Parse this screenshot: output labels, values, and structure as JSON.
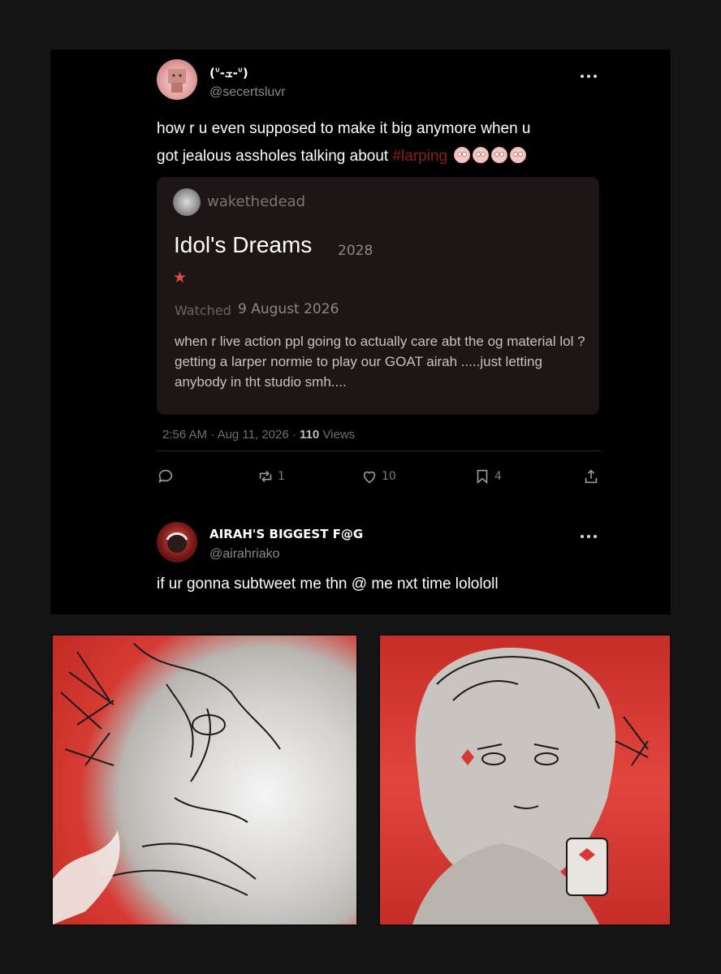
{
  "post": {
    "name": "(ᐡ-ܫ-ᐡ)",
    "handle": "@secertsluvr",
    "text_line1": "how r u even supposed to make it big anymore when u",
    "text_line2_prefix": "got jealous assholes talking about ",
    "hashtag": "#larping",
    "emoji_count": 4,
    "emoji_icon": "eye-roll-emoji-icon",
    "card": {
      "user": "wakethedead",
      "film_title": "Idol's Dreams",
      "film_year": "2028",
      "rating_stars": 1,
      "watched_label": "Watched",
      "watched_date": "9 August 2026",
      "review": "when r live action ppl going to actually care abt the og material lol ? getting a larper normie to play our GOAT airah .....just letting anybody in tht studio smh...."
    },
    "time": "2:56 AM",
    "date": "Aug 11, 2026",
    "views_count": "110",
    "views_label": "Views",
    "actions": {
      "replies": "",
      "reposts": "1",
      "likes": "10",
      "bookmarks": "4"
    }
  },
  "reply": {
    "name": "AIRAH'S BIGGEST F@G",
    "handle": "@airahriako",
    "text": "if ur gonna subtweet me thn @ me nxt time lolololl"
  },
  "colors": {
    "background": "#151515",
    "panel": "#000000",
    "card": "#1d1616",
    "accent_red": "#d63a33",
    "hashtag": "#8e1c1c"
  }
}
